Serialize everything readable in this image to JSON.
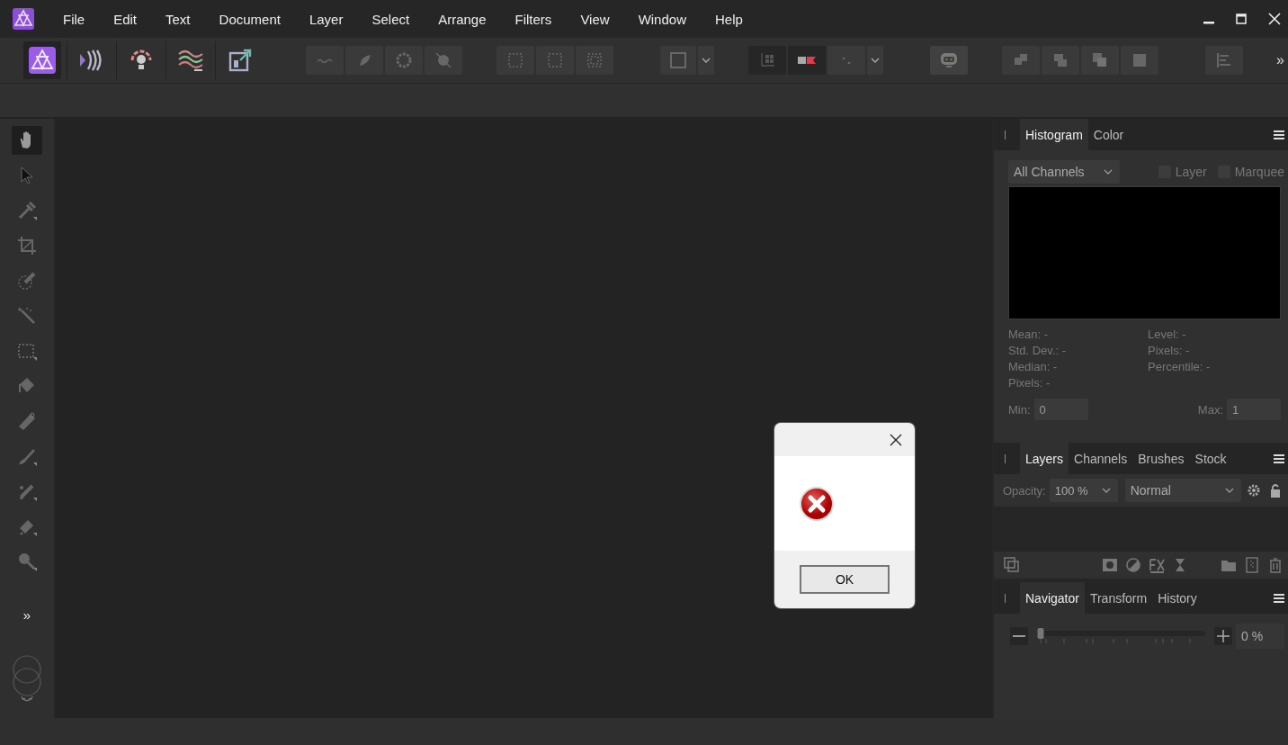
{
  "menu": [
    "File",
    "Edit",
    "Text",
    "Document",
    "Layer",
    "Select",
    "Arrange",
    "Filters",
    "View",
    "Window",
    "Help"
  ],
  "personas": [
    {
      "selected": true
    },
    {
      "selected": false
    },
    {
      "selected": false
    },
    {
      "selected": false
    },
    {
      "selected": false
    }
  ],
  "toolbar_overflow": "»",
  "tools": [
    {
      "selected": true
    },
    {
      "selected": false
    },
    {
      "selected": false
    },
    {
      "selected": false
    },
    {
      "selected": false
    },
    {
      "selected": false
    },
    {
      "selected": false
    },
    {
      "selected": false
    },
    {
      "selected": false
    },
    {
      "selected": false
    },
    {
      "selected": false
    },
    {
      "selected": false
    },
    {
      "selected": false
    }
  ],
  "tools_overflow": "»",
  "histogram": {
    "tabs": [
      {
        "label": "Histogram",
        "selected": true
      },
      {
        "label": "Color",
        "selected": false
      }
    ],
    "channel": "All Channels",
    "options": [
      {
        "label": "Layer",
        "checked": false
      },
      {
        "label": "Marquee",
        "checked": false
      }
    ],
    "stats_left": [
      "Mean: -",
      "Std. Dev.: -",
      "Median: -",
      "Pixels: -"
    ],
    "stats_right": [
      "Level: -",
      "Pixels: -",
      "Percentile: -"
    ],
    "min": {
      "label": "Min:",
      "value": "0"
    },
    "max": {
      "label": "Max:",
      "value": "1"
    }
  },
  "layers": {
    "tabs": [
      {
        "label": "Layers",
        "selected": true
      },
      {
        "label": "Channels",
        "selected": false
      },
      {
        "label": "Brushes",
        "selected": false
      },
      {
        "label": "Stock",
        "selected": false
      }
    ],
    "opacity_label": "Opacity:",
    "opacity": "100 %",
    "blend_mode": "Normal"
  },
  "navigator": {
    "tabs": [
      {
        "label": "Navigator",
        "selected": true
      },
      {
        "label": "Transform",
        "selected": false
      },
      {
        "label": "History",
        "selected": false
      }
    ],
    "zoom": {
      "level": 0,
      "reading": "0 %"
    }
  },
  "dialog": {
    "button": "OK"
  }
}
